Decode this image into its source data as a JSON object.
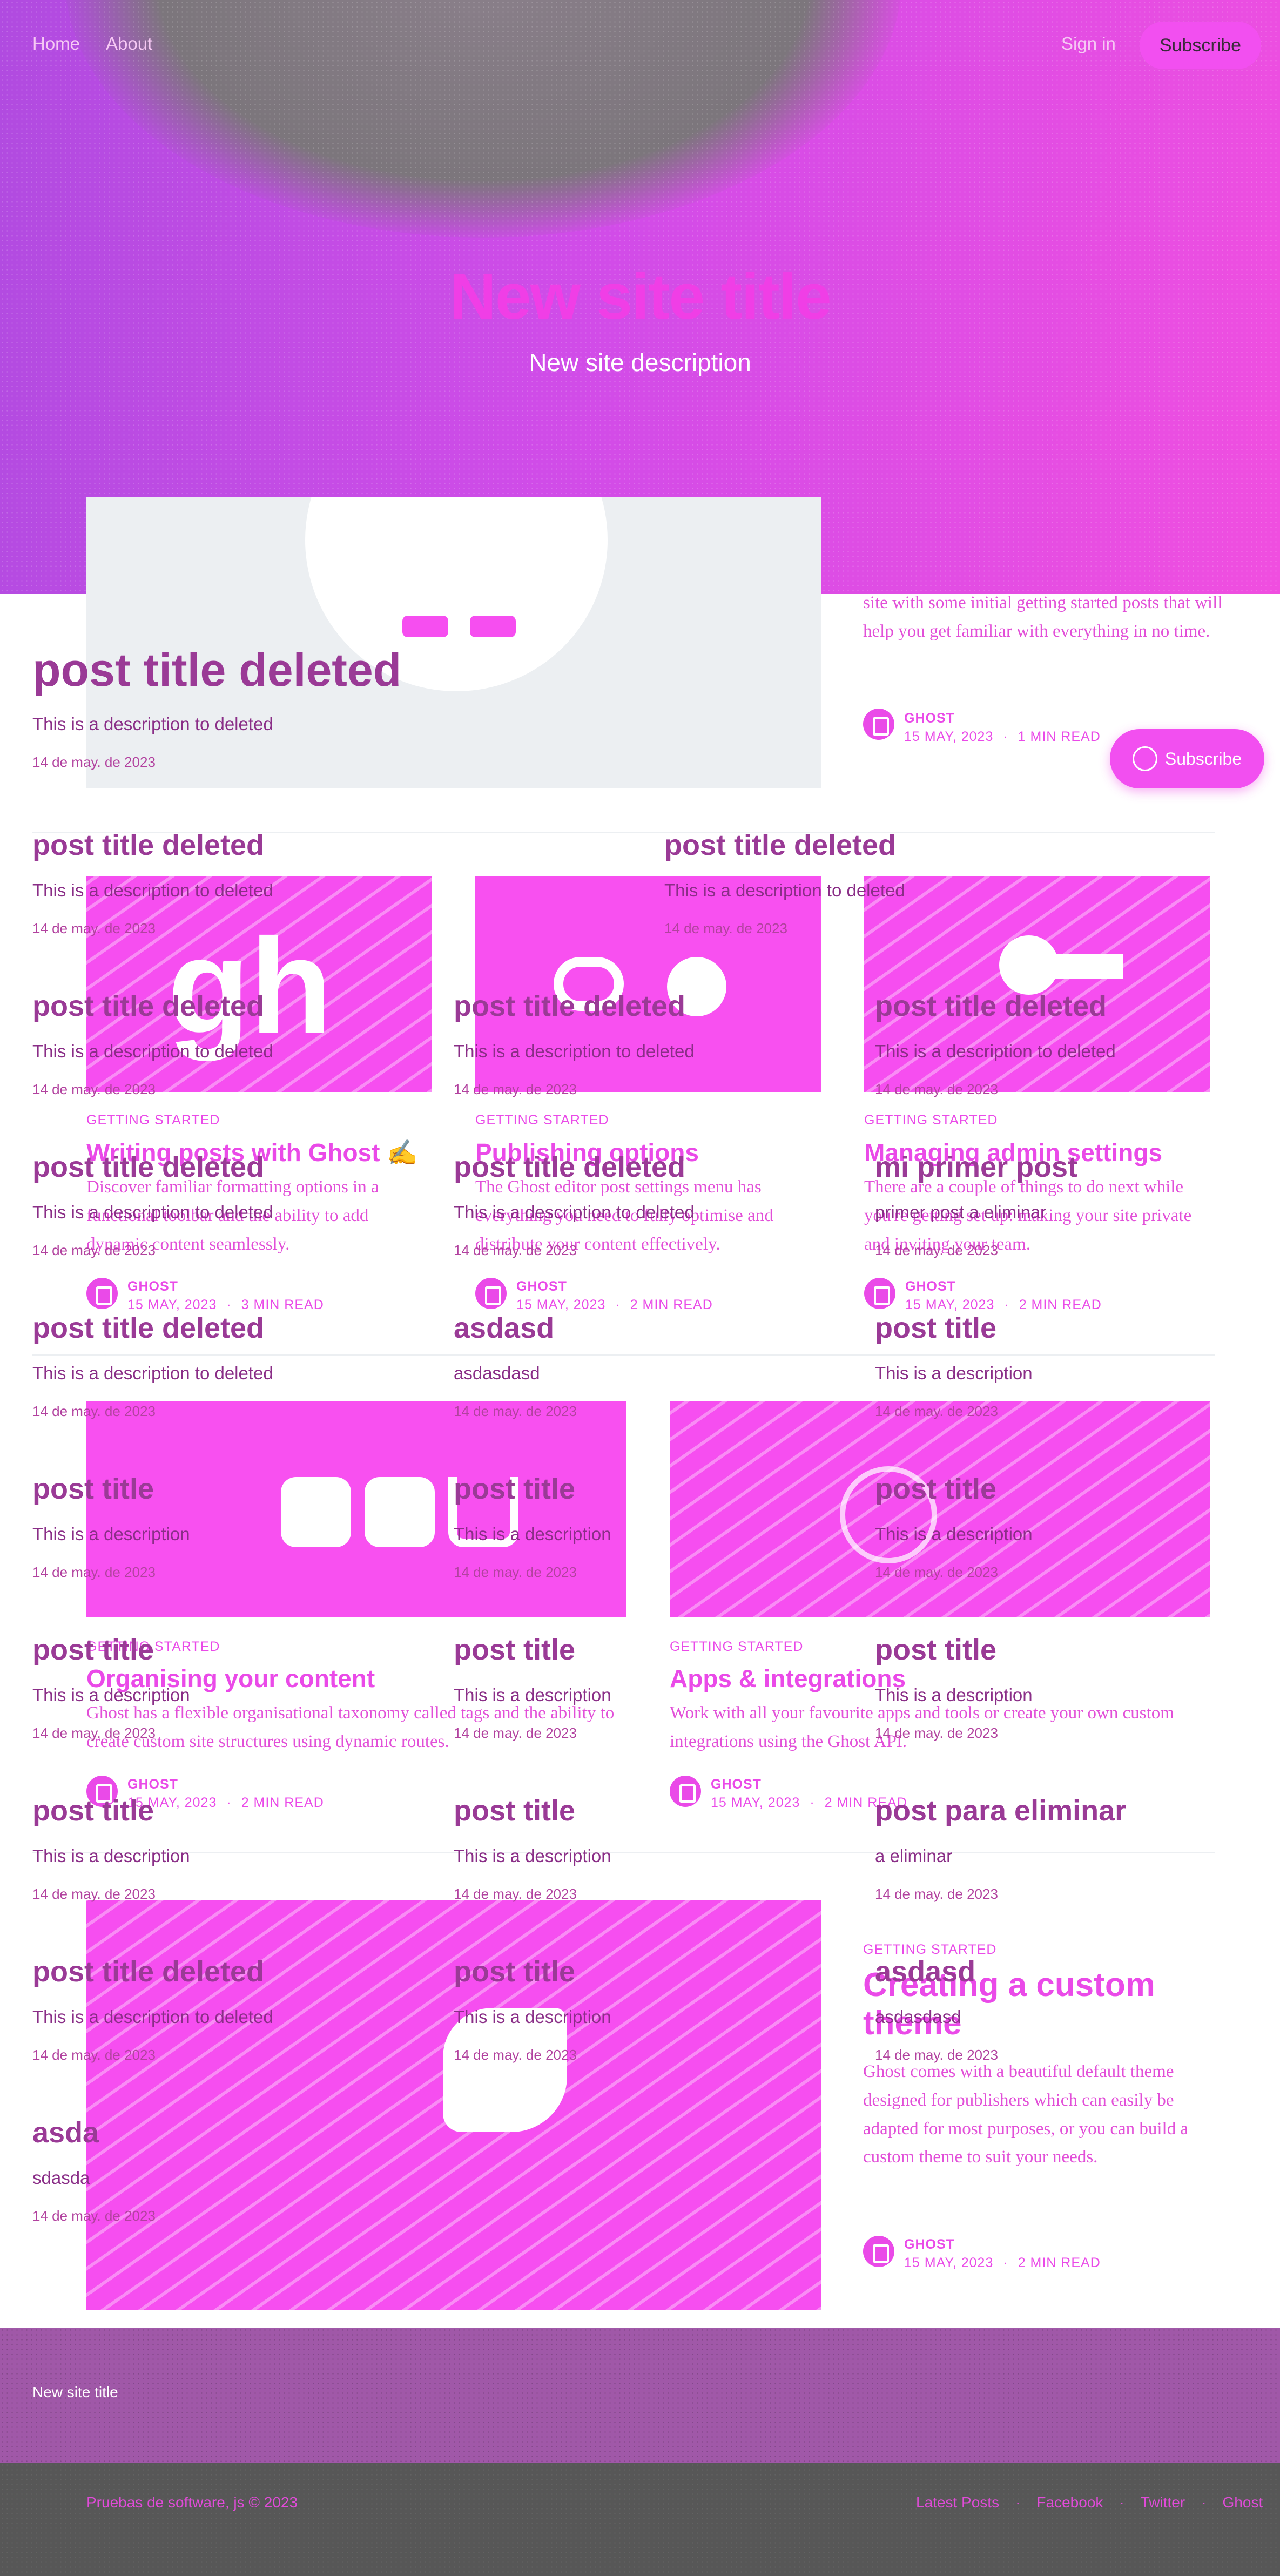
{
  "nav": {
    "home": "Home",
    "about": "About",
    "signin": "Sign in",
    "subscribe": "Subscribe"
  },
  "hero": {
    "title": "New site title",
    "description": "New site description"
  },
  "feature": {
    "excerpt": "site with some initial getting started posts that will help you get familiar with everything in no time.",
    "author": "GHOST",
    "date": "15 MAY, 2023",
    "read": "1 MIN READ"
  },
  "floating_subscribe": "Subscribe",
  "cards_row1": [
    {
      "tag": "GETTING STARTED",
      "title": "Writing posts with Ghost ✍️",
      "excerpt": "Discover familiar formatting options in a functional toolbar and the ability to add dynamic content seamlessly.",
      "author": "GHOST",
      "date": "15 MAY, 2023",
      "read": "3 MIN READ"
    },
    {
      "tag": "GETTING STARTED",
      "title": "Publishing options",
      "excerpt": "The Ghost editor post settings menu has everything you need to fully optimise and distribute your content effectively.",
      "author": "GHOST",
      "date": "15 MAY, 2023",
      "read": "2 MIN READ"
    },
    {
      "tag": "GETTING STARTED",
      "title": "Managing admin settings",
      "excerpt": "There are a couple of things to do next while you're getting set up: making your site private and inviting your team.",
      "author": "GHOST",
      "date": "15 MAY, 2023",
      "read": "2 MIN READ"
    }
  ],
  "cards_row2": [
    {
      "tag": "GETTING STARTED",
      "title": "Organising your content",
      "excerpt": "Ghost has a flexible organisational taxonomy called tags and the ability to create custom site structures using dynamic routes.",
      "author": "GHOST",
      "date": "15 MAY, 2023",
      "read": "2 MIN READ"
    },
    {
      "tag": "GETTING STARTED",
      "title": "Apps & integrations",
      "excerpt": "Work with all your favourite apps and tools or create your own custom integrations using the Ghost API.",
      "author": "GHOST",
      "date": "15 MAY, 2023",
      "read": "2 MIN READ"
    }
  ],
  "card_custom_theme": {
    "tag": "GETTING STARTED",
    "title": "Creating a custom theme",
    "excerpt": "Ghost comes with a beautiful default theme designed for publishers which can easily be adapted for most purposes, or you can build a custom theme to suit your needs.",
    "author": "GHOST",
    "date": "15 MAY, 2023",
    "read": "2 MIN READ"
  },
  "overlay_posts": [
    {
      "title": "post title deleted",
      "desc": "This is a description to deleted",
      "date": "14 de may. de 2023"
    },
    {
      "title": "post title deleted",
      "desc": "This is a description to deleted",
      "date": "14 de may. de 2023"
    },
    {
      "title": "post title deleted",
      "desc": "This is a description to deleted",
      "date": "14 de may. de 2023"
    },
    {
      "title": "post title deleted",
      "desc": "This is a description to deleted",
      "date": "14 de may. de 2023"
    },
    {
      "title": "post title deleted",
      "desc": "This is a description to deleted",
      "date": "14 de may. de 2023"
    },
    {
      "title": "post title deleted",
      "desc": "This is a description to deleted",
      "date": "14 de may. de 2023"
    },
    {
      "title": "post title deleted",
      "desc": "This is a description to deleted",
      "date": "14 de may. de 2023"
    },
    {
      "title": "post title deleted",
      "desc": "This is a description to deleted",
      "date": "14 de may. de 2023"
    },
    {
      "title": "post title deleted",
      "desc": "This is a description to deleted",
      "date": "14 de may. de 2023"
    },
    {
      "title": "mi primer post",
      "desc": "primer post a eliminar",
      "date": "14 de may. de 2023"
    },
    {
      "title": "post title deleted",
      "desc": "This is a description to deleted",
      "date": "14 de may. de 2023"
    },
    {
      "title": "asdasd",
      "desc": "asdasdasd",
      "date": "14 de may. de 2023"
    },
    {
      "title": "post title",
      "desc": "This is a description",
      "date": "14 de may. de 2023"
    },
    {
      "title": "post title",
      "desc": "This is a description",
      "date": "14 de may. de 2023"
    },
    {
      "title": "post title",
      "desc": "This is a description",
      "date": "14 de may. de 2023"
    },
    {
      "title": "post title",
      "desc": "This is a description",
      "date": "14 de may. de 2023"
    },
    {
      "title": "post title",
      "desc": "This is a description",
      "date": "14 de may. de 2023"
    },
    {
      "title": "post title",
      "desc": "This is a description",
      "date": "14 de may. de 2023"
    },
    {
      "title": "post title",
      "desc": "This is a description",
      "date": "14 de may. de 2023"
    },
    {
      "title": "post title",
      "desc": "This is a description",
      "date": "14 de may. de 2023"
    },
    {
      "title": "post title",
      "desc": "This is a description",
      "date": "14 de may. de 2023"
    },
    {
      "title": "post para eliminar",
      "desc": "a eliminar",
      "date": "14 de may. de 2023"
    },
    {
      "title": "post title deleted",
      "desc": "This is a description to deleted",
      "date": "14 de may. de 2023"
    },
    {
      "title": "post title",
      "desc": "This is a description",
      "date": "14 de may. de 2023"
    },
    {
      "title": "asdasd",
      "desc": "asdasdasd",
      "date": "14 de may. de 2023"
    },
    {
      "title": "asda",
      "desc": "sdasda",
      "date": "14 de may. de 2023"
    }
  ],
  "footer": {
    "site_title": "New site title",
    "copyright": "Pruebas de software, js © 2023",
    "links": [
      "Latest Posts",
      "Facebook",
      "Twitter",
      "Ghost"
    ]
  }
}
